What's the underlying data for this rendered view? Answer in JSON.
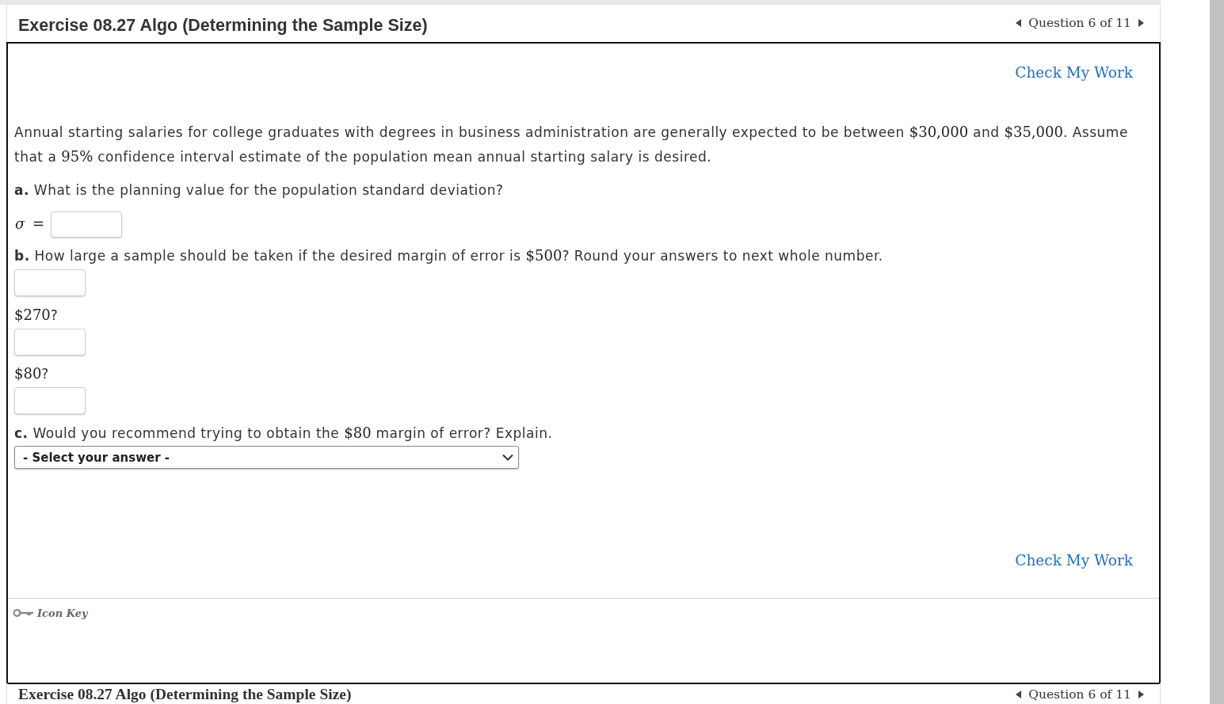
{
  "header": {
    "title": "Exercise 08.27 Algo (Determining the Sample Size)",
    "question_counter": "Question 6 of 11"
  },
  "check_my_work_top": "Check My Work",
  "question": {
    "intro": [
      {
        "kind": "text",
        "text": "Annual starting salaries for college graduates with degrees in business administration are generally expected to be between "
      },
      {
        "kind": "math",
        "text": "$30,000"
      },
      {
        "kind": "text",
        "text": " and "
      },
      {
        "kind": "math",
        "text": "$35,000"
      },
      {
        "kind": "text",
        "text": ". Assume that a "
      },
      {
        "kind": "math",
        "text": "95%"
      },
      {
        "kind": "text",
        "text": " confidence interval estimate of the population mean annual starting salary is desired."
      }
    ],
    "items": [
      {
        "kind": "prompt",
        "segments": [
          {
            "kind": "text",
            "text": "**a.** What is the planning value for the population standard deviation?"
          }
        ]
      },
      {
        "kind": "answer",
        "label": "*σ* ="
      },
      {
        "kind": "prompt",
        "segments": [
          {
            "kind": "text",
            "text": "**b.** How large a sample should be taken if the desired margin of error is "
          },
          {
            "kind": "math",
            "text": "$500"
          },
          {
            "kind": "text",
            "text": "? Round your answers to next whole number."
          }
        ]
      },
      {
        "kind": "answer"
      },
      {
        "kind": "prompt",
        "segments": [
          {
            "kind": "math",
            "text": "$270"
          },
          {
            "kind": "text",
            "text": "?"
          }
        ]
      },
      {
        "kind": "answer"
      },
      {
        "kind": "prompt",
        "segments": [
          {
            "kind": "math",
            "text": "$80"
          },
          {
            "kind": "text",
            "text": "?"
          }
        ]
      },
      {
        "kind": "answer"
      },
      {
        "kind": "prompt",
        "segments": [
          {
            "kind": "text",
            "text": "**c.** Would you recommend trying to obtain the "
          },
          {
            "kind": "math",
            "text": "$80"
          },
          {
            "kind": "text",
            "text": " margin of error? Explain."
          }
        ]
      },
      {
        "kind": "select",
        "text": "- Select your answer -"
      }
    ]
  },
  "check_my_work_bottom": "Check My Work",
  "icon_key": {
    "label": "Icon Key"
  },
  "footer": {
    "title": "Exercise 08.27 Algo (Determining the Sample Size)",
    "question_counter": "Question 6 of 11"
  }
}
